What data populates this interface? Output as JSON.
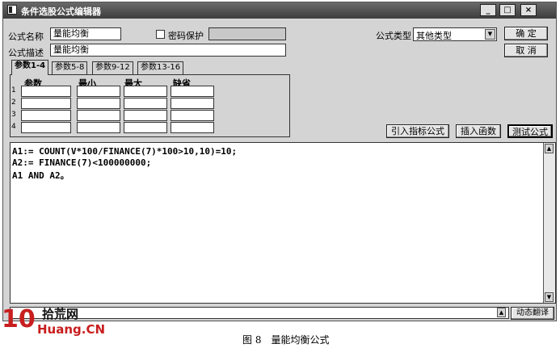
{
  "window": {
    "title": "条件选股公式编辑器",
    "controls": {
      "minimize": "_",
      "maximize": "□",
      "close": "×"
    }
  },
  "form": {
    "name_label": "公式名称",
    "name_value": "量能均衡",
    "password_label": "密码保护",
    "password_checked": false,
    "desc_label": "公式描述",
    "desc_value": "量能均衡",
    "type_label": "公式类型",
    "type_value": "其他类型"
  },
  "buttons": {
    "ok": "确  定",
    "cancel": "取  消",
    "import_indicator": "引入指标公式",
    "insert_function": "插入函数",
    "test_formula": "测试公式",
    "dynamic_translate": "动态翻译"
  },
  "tabs": [
    "参数1-4",
    "参数5-8",
    "参数9-12",
    "参数13-16"
  ],
  "params": {
    "headers": [
      "参数",
      "最小",
      "最大",
      "缺省"
    ],
    "rows": [
      "1",
      "2",
      "3",
      "4"
    ]
  },
  "editor": {
    "lines": [
      "A1:= COUNT(V*100/FINANCE(7)*100>10,10)=10;",
      "A2:= FINANCE(7)<100000000;",
      "A1 AND A2。"
    ]
  },
  "watermark": {
    "number": "10",
    "cn": "拾荒网",
    "url": "Huang.CN"
  },
  "caption": "图 8　量能均衡公式",
  "colors": {
    "logo_red": "#c81e1e",
    "titlebar": "#4a4a4a"
  }
}
